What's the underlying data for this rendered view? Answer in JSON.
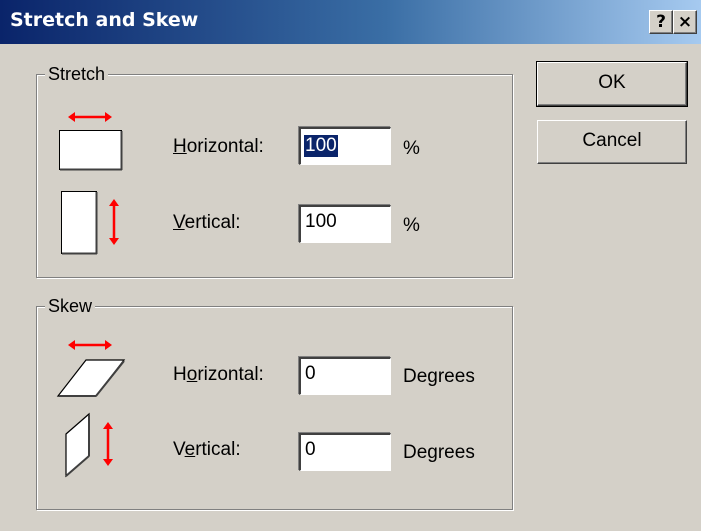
{
  "window": {
    "title": "Stretch and Skew",
    "help_glyph": "?",
    "close_glyph": "×"
  },
  "stretch": {
    "group_label": "Stretch",
    "horizontal": {
      "label_accel": "H",
      "label_rest": "orizontal:",
      "value": "100",
      "unit": "%"
    },
    "vertical": {
      "label_accel": "V",
      "label_rest": "ertical:",
      "value": "100",
      "unit": "%"
    }
  },
  "skew": {
    "group_label": "Skew",
    "horizontal": {
      "label_pre": "H",
      "label_accel": "o",
      "label_rest": "rizontal:",
      "value": "0",
      "unit": "Degrees"
    },
    "vertical": {
      "label_pre": "V",
      "label_accel": "e",
      "label_rest": "rtical:",
      "value": "0",
      "unit": "Degrees"
    }
  },
  "buttons": {
    "ok_label": "OK",
    "cancel_label": "Cancel"
  },
  "colors": {
    "title_start": "#0a246a",
    "title_end": "#a6caf0",
    "arrow": "#ff0000",
    "face": "#d4d0c8"
  },
  "icons": {
    "stretch_horizontal": "stretch-horizontal-icon",
    "stretch_vertical": "stretch-vertical-icon",
    "skew_horizontal": "skew-horizontal-icon",
    "skew_vertical": "skew-vertical-icon"
  }
}
